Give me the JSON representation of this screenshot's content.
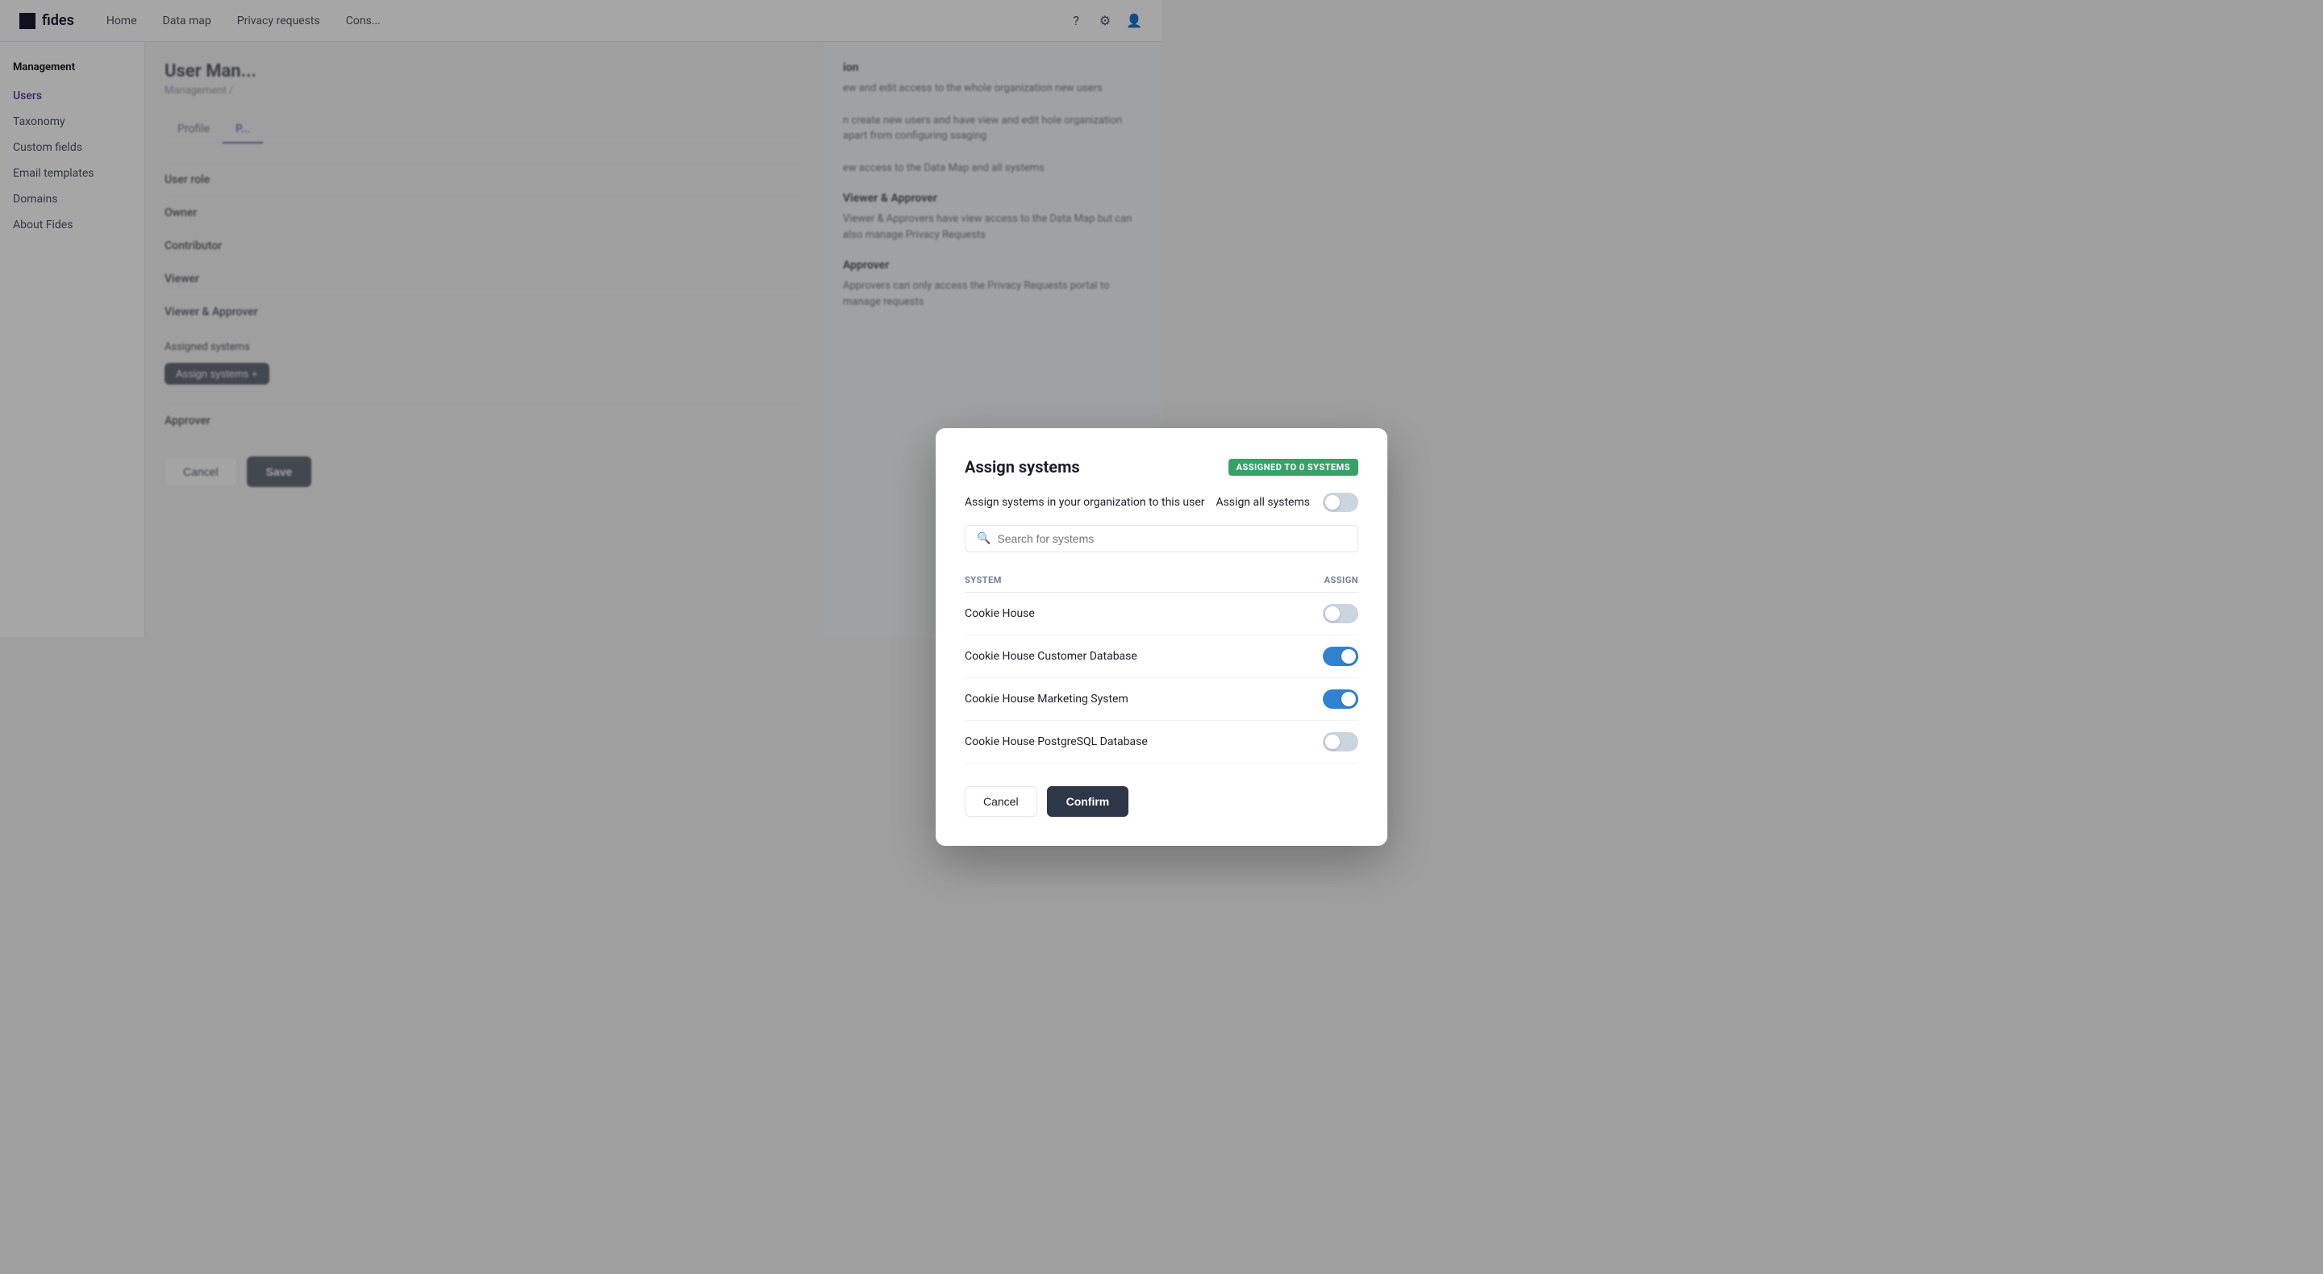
{
  "app": {
    "logo_text": "fides",
    "nav_links": [
      "Home",
      "Data map",
      "Privacy requests",
      "Cons..."
    ],
    "nav_icons": [
      "help",
      "settings",
      "user"
    ]
  },
  "sidebar": {
    "section_title": "Management",
    "items": [
      {
        "label": "Users",
        "active": true
      },
      {
        "label": "Taxonomy",
        "active": false
      },
      {
        "label": "Custom fields",
        "active": false
      },
      {
        "label": "Email templates",
        "active": false
      },
      {
        "label": "Domains",
        "active": false
      },
      {
        "label": "About Fides",
        "active": false
      }
    ]
  },
  "content": {
    "page_title": "User Man...",
    "breadcrumb": "Management /",
    "tabs": [
      {
        "label": "Profile",
        "active": false
      },
      {
        "label": "P...",
        "active": true
      }
    ],
    "user_role_label": "User role",
    "roles": [
      {
        "label": "Owner"
      },
      {
        "label": "Contributor"
      },
      {
        "label": "Viewer"
      },
      {
        "label": "Viewer & Approver",
        "checked": true
      },
      {
        "label": "Approver"
      }
    ],
    "assigned_systems_label": "Assigned systems",
    "assign_btn_label": "Assign systems +",
    "cancel_label": "Cancel",
    "save_label": "Save"
  },
  "right_panel": {
    "sections": [
      {
        "title": "ion",
        "text": "ew and edit access to the whole organization\nnew users"
      },
      {
        "title": "",
        "text": "n create new users and have view and edit\nhole organization apart from configuring\nssaging"
      },
      {
        "title": "",
        "text": "ew access to the Data Map and all systems"
      },
      {
        "title": "Viewer & Approver",
        "text": "Viewer & Approvers have view access to the Data Map but can\nalso manage Privacy Requests"
      },
      {
        "title": "Approver",
        "text": "Approvers can only access the Privacy Requests portal to\nmanage requests"
      }
    ]
  },
  "modal": {
    "title": "Assign systems",
    "badge_label": "ASSIGNED TO 0 SYSTEMS",
    "description": "Assign systems in your organization to this user",
    "assign_all_label": "Assign all systems",
    "search_placeholder": "Search for systems",
    "col_system": "SYSTEM",
    "col_assign": "ASSIGN",
    "systems": [
      {
        "name": "Cookie House",
        "assigned": false
      },
      {
        "name": "Cookie House Customer Database",
        "assigned": true
      },
      {
        "name": "Cookie House Marketing System",
        "assigned": true
      },
      {
        "name": "Cookie House PostgreSQL Database",
        "assigned": false
      }
    ],
    "cancel_label": "Cancel",
    "confirm_label": "Confirm"
  }
}
